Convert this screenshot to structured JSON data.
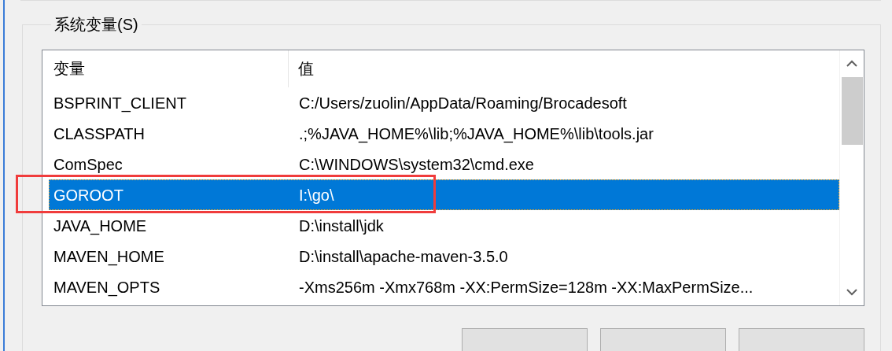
{
  "group": {
    "title": "系统变量(S)"
  },
  "table": {
    "columns": [
      "变量",
      "值"
    ],
    "rows": [
      {
        "cells": [
          "BSPRINT_CLIENT",
          "C:/Users/zuolin/AppData/Roaming/Brocadesoft"
        ],
        "selected": false,
        "highlighted": false
      },
      {
        "cells": [
          "CLASSPATH",
          ".;%JAVA_HOME%\\lib;%JAVA_HOME%\\lib\\tools.jar"
        ],
        "selected": false,
        "highlighted": false
      },
      {
        "cells": [
          "ComSpec",
          "C:\\WINDOWS\\system32\\cmd.exe"
        ],
        "selected": false,
        "highlighted": false
      },
      {
        "cells": [
          "GOROOT",
          "I:\\go\\"
        ],
        "selected": true,
        "highlighted": true
      },
      {
        "cells": [
          "JAVA_HOME",
          "D:\\install\\jdk"
        ],
        "selected": false,
        "highlighted": false
      },
      {
        "cells": [
          "MAVEN_HOME",
          "D:\\install\\apache-maven-3.5.0"
        ],
        "selected": false,
        "highlighted": false
      },
      {
        "cells": [
          "MAVEN_OPTS",
          "-Xms256m -Xmx768m -XX:PermSize=128m -XX:MaxPermSize..."
        ],
        "selected": false,
        "highlighted": false
      }
    ]
  }
}
